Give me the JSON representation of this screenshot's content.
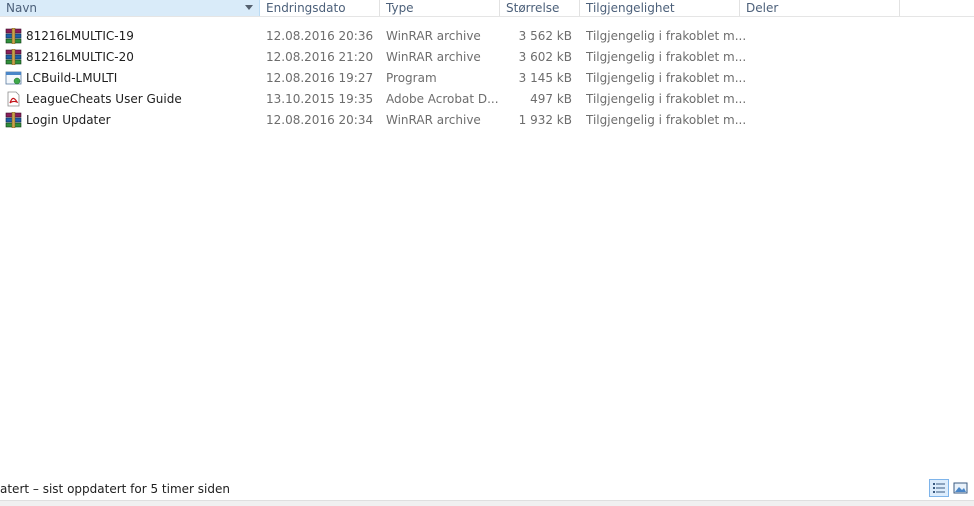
{
  "columns": {
    "name": "Navn",
    "date": "Endringsdato",
    "type": "Type",
    "size": "Størrelse",
    "availability": "Tilgjengelighet",
    "share": "Deler"
  },
  "files": [
    {
      "name": "81216LMULTIC-19",
      "date": "12.08.2016 20:36",
      "type": "WinRAR archive",
      "size": "3 562 kB",
      "availability": "Tilgjengelig i frakoblet m...",
      "icon": "winrar-archive-icon"
    },
    {
      "name": "81216LMULTIC-20",
      "date": "12.08.2016 21:20",
      "type": "WinRAR archive",
      "size": "3 602 kB",
      "availability": "Tilgjengelig i frakoblet m...",
      "icon": "winrar-archive-icon"
    },
    {
      "name": "LCBuild-LMULTI",
      "date": "12.08.2016 19:27",
      "type": "Program",
      "size": "3 145 kB",
      "availability": "Tilgjengelig i frakoblet m...",
      "icon": "program-icon"
    },
    {
      "name": "LeagueCheats User Guide",
      "date": "13.10.2015 19:35",
      "type": "Adobe Acrobat D...",
      "size": "497 kB",
      "availability": "Tilgjengelig i frakoblet m...",
      "icon": "pdf-icon"
    },
    {
      "name": "Login Updater",
      "date": "12.08.2016 20:34",
      "type": "WinRAR archive",
      "size": "1 932 kB",
      "availability": "Tilgjengelig i frakoblet m...",
      "icon": "winrar-archive-icon"
    }
  ],
  "status": {
    "text": "atert – sist oppdatert for 5 timer siden"
  },
  "view_buttons": [
    "details-view-icon",
    "large-icons-view-icon"
  ],
  "colors": {
    "header_text": "#4c607a",
    "sorted_header_bg": "#d9ebf9",
    "secondary_text": "#6d6d6d"
  }
}
